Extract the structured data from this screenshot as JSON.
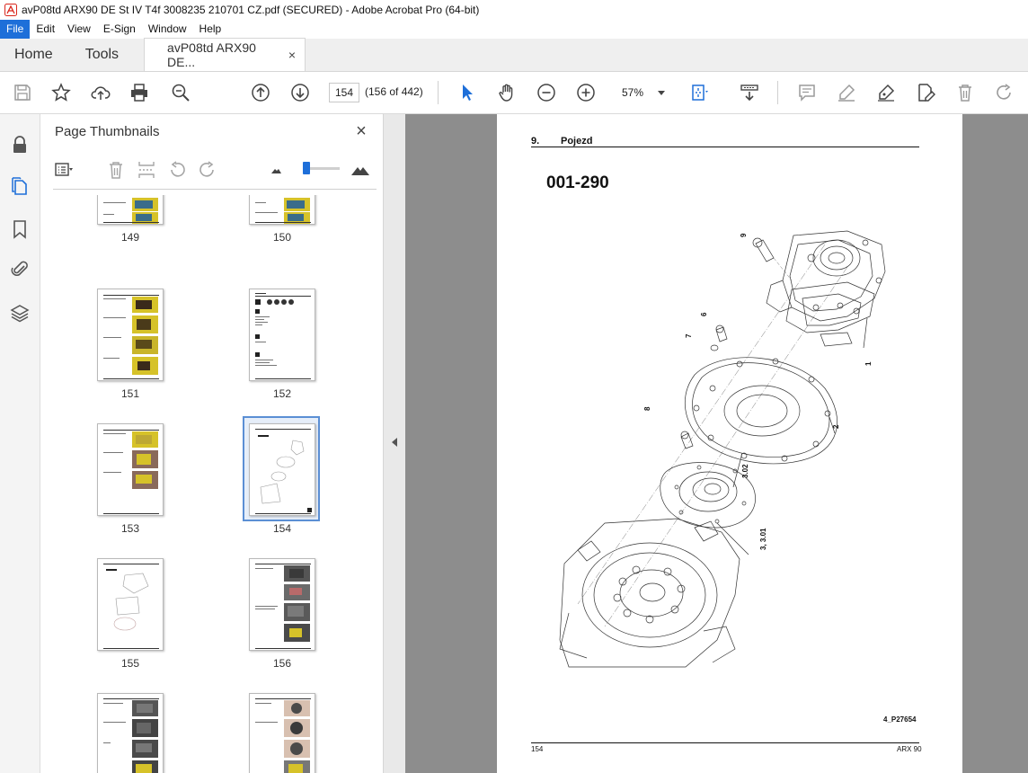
{
  "window": {
    "title": "avP08td ARX90 DE St IV T4f 3008235 210701 CZ.pdf (SECURED) - Adobe Acrobat Pro (64-bit)"
  },
  "menu": {
    "items": [
      "File",
      "Edit",
      "View",
      "E-Sign",
      "Window",
      "Help"
    ],
    "active": "File"
  },
  "tabs": {
    "home": "Home",
    "tools": "Tools",
    "document": "avP08td ARX90 DE...",
    "close_glyph": "×"
  },
  "toolbar": {
    "page_value": "154",
    "page_count": "(156 of 442)",
    "zoom": "57%"
  },
  "thumbnails": {
    "panel_title": "Page Thumbnails",
    "close_glyph": "×",
    "selected_page": "154",
    "pages": [
      {
        "label": "149"
      },
      {
        "label": "150"
      },
      {
        "label": "151"
      },
      {
        "label": "152"
      },
      {
        "label": "153"
      },
      {
        "label": "154"
      },
      {
        "label": "155"
      },
      {
        "label": "156"
      },
      {
        "label": ""
      },
      {
        "label": ""
      }
    ]
  },
  "document": {
    "section_number": "9.",
    "section_title": "Pojezd",
    "figure_title": "001-290",
    "figure_code": "4_P27654",
    "footer_page": "154",
    "footer_model": "ARX 90",
    "callouts": [
      "9",
      "6",
      "7",
      "1",
      "8",
      "2",
      "3.02",
      "3, 3.01"
    ]
  },
  "colors": {
    "accent": "#1e6fd9",
    "doc_background": "#8d8d8d",
    "thumb_selected_border": "#5b8fd4"
  }
}
